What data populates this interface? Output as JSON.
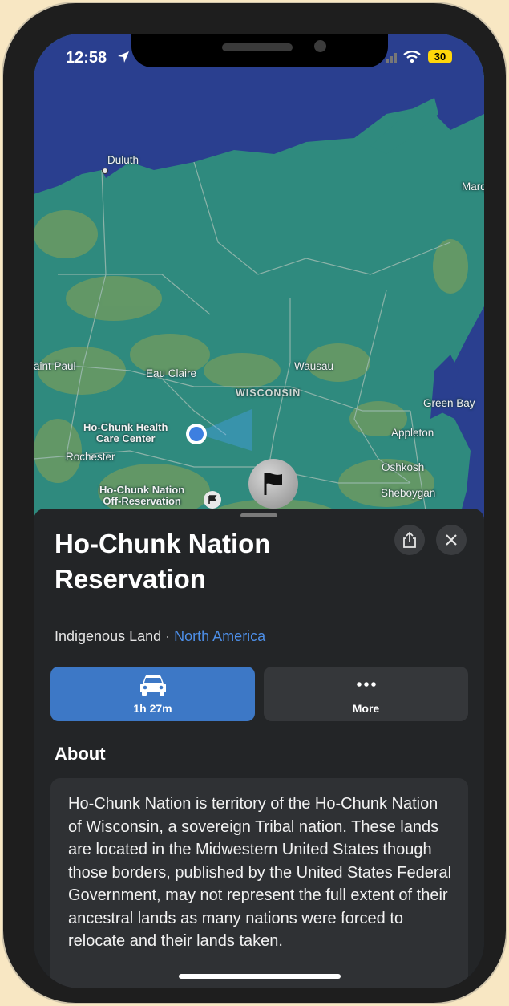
{
  "status_bar": {
    "time": "12:58",
    "battery": "30"
  },
  "map": {
    "labels": {
      "duluth": "Duluth",
      "marquette": "Marq",
      "saint_paul": "aint Paul",
      "eau_claire": "Eau Claire",
      "wausau": "Wausau",
      "wisconsin": "WISCONSIN",
      "green_bay": "Green Bay",
      "appleton": "Appleton",
      "rochester": "Rochester",
      "oshkosh": "Oshkosh",
      "sheboygan": "Sheboygan",
      "health_center": "Ho-Chunk Health\nCare Center",
      "off_reservation": "Ho-Chunk Nation\nOff-Reservation"
    }
  },
  "sheet": {
    "title": "Ho-Chunk Nation Reservation",
    "category": "Indigenous Land",
    "separator": "·",
    "region": "North America",
    "directions_label": "1h 27m",
    "more_label": "More",
    "about_heading": "About",
    "about_text": "Ho-Chunk Nation is territory of the Ho-Chunk Nation of Wisconsin, a sovereign Tribal nation. These lands are located in the Midwestern United States though those borders, published by the United States Federal Government, may not represent the full extent of their ancestral lands as many nations were forced to relocate and their lands taken."
  },
  "colors": {
    "accent": "#3d78c6",
    "link": "#4d8fe8",
    "sheet_bg": "#232527",
    "battery": "#ffd60a"
  },
  "icons": [
    "location-arrow-icon",
    "wifi-icon",
    "signal-icon",
    "share-icon",
    "close-icon",
    "car-icon",
    "ellipsis-icon",
    "flag-icon",
    "user-location-icon"
  ]
}
